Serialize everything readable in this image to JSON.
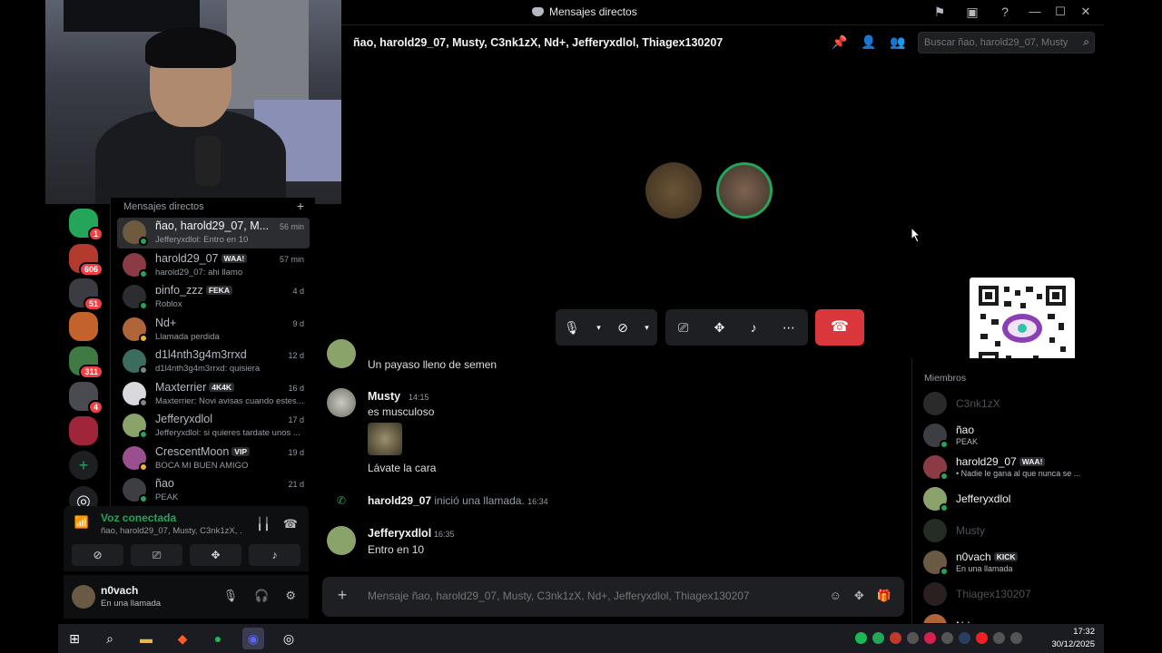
{
  "window": {
    "title": "Mensajes directos"
  },
  "header": {
    "group_name": "ñao, harold29_07, Musty, C3nk1zX, Nd+, Jefferyxdlol, Thiagex130207",
    "search_placeholder": "Buscar ñao, harold29_07, Musty, ..."
  },
  "servers": [
    {
      "color": "#23a55a",
      "badge": "1"
    },
    {
      "color": "#b33b2e",
      "badge": "606"
    },
    {
      "color": "#3b3c41",
      "badge": "51"
    },
    {
      "color": "#c4622d",
      "badge": ""
    },
    {
      "color": "#3f7a45",
      "badge": "311"
    },
    {
      "color": "#4a4b50",
      "badge": "4"
    },
    {
      "color": "#a0243a",
      "badge": ""
    }
  ],
  "dm": {
    "title": "Mensajes directos",
    "items": [
      {
        "name": "ñao, harold29_07, M...",
        "sub": "Jefferyxdlol: Entro en 10",
        "time": "56 min",
        "tag": "",
        "avatar": "#6d5a3f",
        "status": "online"
      },
      {
        "name": "harold29_07",
        "sub": "harold29_07: ahi llamo",
        "time": "57 min",
        "tag": "WAA!",
        "avatar": "#8b3b44",
        "status": "online"
      },
      {
        "name": "ɒinfo_zzz",
        "sub": "Roblox",
        "time": "4 d",
        "tag": "FEKA",
        "avatar": "#2c2d31",
        "status": "online"
      },
      {
        "name": "Nd+",
        "sub": "Llamada perdida",
        "time": "9 d",
        "tag": "",
        "avatar": "#b0643a",
        "status": "idle"
      },
      {
        "name": "d1l4nth3g4m3rrxd",
        "sub": "d1l4nth3g4m3rrxd: quisiera",
        "time": "12 d",
        "tag": "",
        "avatar": "#3a6d5d",
        "status": "off"
      },
      {
        "name": "Maxterrier",
        "sub": "Maxterrier: Novi avisas cuando estes...",
        "time": "16 d",
        "tag": "4K4K",
        "avatar": "#d9d9dd",
        "status": "off"
      },
      {
        "name": "Jefferyxdlol",
        "sub": "Jefferyxdlol: si quieres tardate unos ...",
        "time": "17 d",
        "tag": "",
        "avatar": "#8aa36b",
        "status": "online"
      },
      {
        "name": "CrescentMoon",
        "sub": "BOCA MI BUEN AMIGO",
        "time": "19 d",
        "tag": "VIP",
        "avatar": "#9a4f8f",
        "status": "idle"
      },
      {
        "name": "ñao",
        "sub": "PEAK",
        "time": "21 d",
        "tag": "",
        "avatar": "#3d3e44",
        "status": "online"
      }
    ]
  },
  "voice": {
    "title": "Voz conectada",
    "sub": "ñao, harold29_07, Musty, C3nk1zX, ..."
  },
  "user": {
    "name": "n0vach",
    "status": "En una llamada"
  },
  "chat": {
    "messages": [
      {
        "text": "Un payaso lleno de semen"
      },
      {
        "author": "Musty",
        "time": "14:15",
        "text": "es musculoso",
        "text2": "Lávate la cara"
      },
      {
        "author": "harold29_07",
        "system": "inició una llamada.",
        "time": "16:34"
      },
      {
        "author": "Jefferyxdlol",
        "time": "16:35",
        "text": "Entro en 10"
      }
    ],
    "composer_placeholder": "Mensaje ñao, harold29_07, Musty, C3nk1zX, Nd+, Jefferyxdlol, Thiagex130207"
  },
  "members": {
    "title": "Miembros",
    "list": [
      {
        "name": "C3nk1zX",
        "sub": "",
        "off": true,
        "avatar": "#777"
      },
      {
        "name": "ñao",
        "sub": "PEAK",
        "off": false,
        "avatar": "#3d3e44"
      },
      {
        "name": "harold29_07",
        "tag": "WAA!",
        "sub": "• Nadie le gana al que nunca se ...",
        "off": false,
        "avatar": "#8b3b44"
      },
      {
        "name": "Jefferyxdlol",
        "sub": "",
        "off": false,
        "avatar": "#8aa36b"
      },
      {
        "name": "Musty",
        "sub": "",
        "off": true,
        "avatar": "#6b7a6b"
      },
      {
        "name": "n0vach",
        "tag": "KICK",
        "sub": "En una llamada",
        "off": false,
        "avatar": "#6a5a44"
      },
      {
        "name": "Thiagex130207",
        "sub": "",
        "off": true,
        "avatar": "#7b5c5c"
      },
      {
        "name": "Nd+",
        "sub": "",
        "off": false,
        "avatar": "#b0643a"
      }
    ]
  },
  "clock": {
    "time": "17:32",
    "date": "30/12/2025"
  }
}
